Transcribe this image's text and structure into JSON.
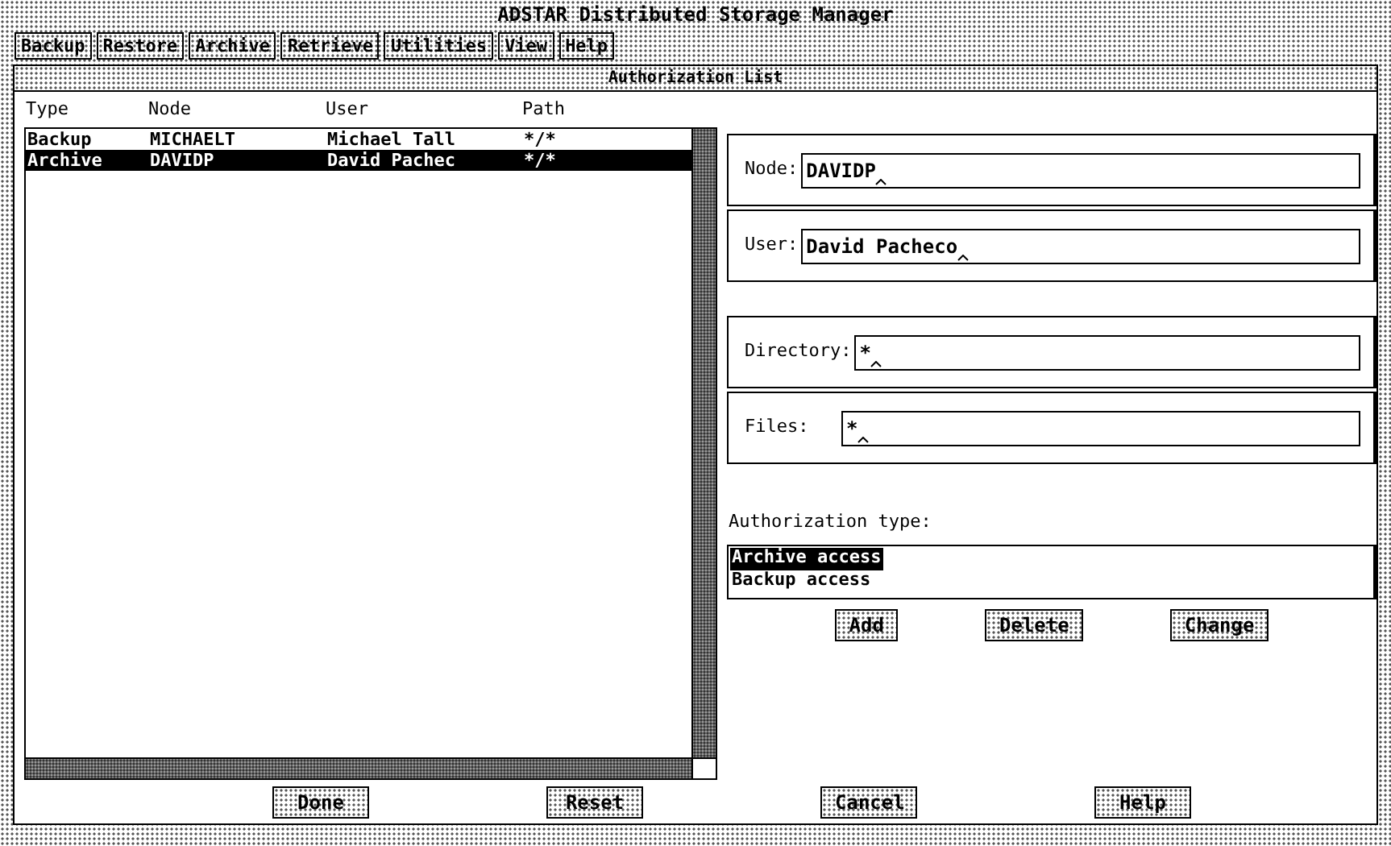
{
  "window": {
    "title": "ADSTAR Distributed Storage Manager"
  },
  "menu": [
    {
      "label": "Backup"
    },
    {
      "label": "Restore"
    },
    {
      "label": "Archive"
    },
    {
      "label": "Retrieve"
    },
    {
      "label": "Utilities"
    },
    {
      "label": "View"
    },
    {
      "label": "Help"
    }
  ],
  "panel": {
    "title": "Authorization List"
  },
  "list": {
    "columns": [
      "Type",
      "Node",
      "User",
      "Path"
    ],
    "rows": [
      {
        "cells": [
          "Backup",
          "MICHAELT",
          "Michael Tall",
          "*/*"
        ],
        "selected": false
      },
      {
        "cells": [
          "Archive",
          "DAVIDP",
          "David Pachec",
          "*/*"
        ],
        "selected": true
      }
    ]
  },
  "fields": [
    {
      "label": "Node:",
      "value": "DAVIDP"
    },
    {
      "label": "User:",
      "value": "David Pacheco"
    },
    {
      "label": "Directory:",
      "value": "*"
    },
    {
      "label": "Files:",
      "value": "*"
    }
  ],
  "authorization_type": {
    "label": "Authorization type:",
    "options": [
      {
        "label": "Archive access",
        "selected": true
      },
      {
        "label": "Backup access",
        "selected": false
      }
    ]
  },
  "actions": [
    "Add",
    "Delete",
    "Change"
  ],
  "buttons": [
    "Done",
    "Reset",
    "Cancel",
    "Help"
  ]
}
